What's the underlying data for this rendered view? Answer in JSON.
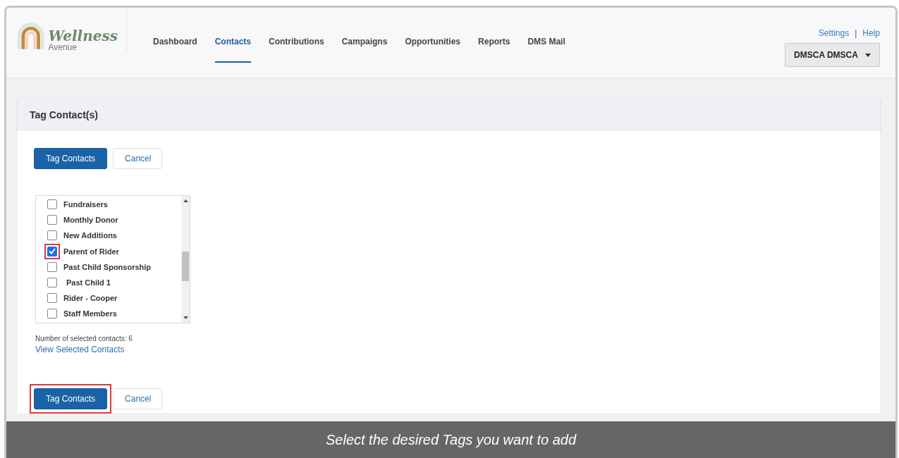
{
  "brand": {
    "name": "Wellness",
    "sub": "Avenue"
  },
  "nav": [
    {
      "label": "Dashboard",
      "selected": false
    },
    {
      "label": "Contacts",
      "selected": true
    },
    {
      "label": "Contributions",
      "selected": false
    },
    {
      "label": "Campaigns",
      "selected": false
    },
    {
      "label": "Opportunities",
      "selected": false
    },
    {
      "label": "Reports",
      "selected": false
    },
    {
      "label": "DMS Mail",
      "selected": false
    }
  ],
  "top_links": [
    "Settings",
    "Help"
  ],
  "separator": "|",
  "user_menu": "DMSCA DMSCA",
  "panel_title": "Tag Contact(s)",
  "top_buttons": [
    {
      "label": "Tag Contacts",
      "kind": "primary",
      "highlighted": false
    },
    {
      "label": "Cancel",
      "kind": "secondary",
      "highlighted": false
    }
  ],
  "tags": [
    {
      "label": "Fundraisers",
      "checked": false,
      "highlighted": false,
      "indented": false
    },
    {
      "label": "Monthly Donor",
      "checked": false,
      "highlighted": false,
      "indented": false
    },
    {
      "label": "New Additions",
      "checked": false,
      "highlighted": false,
      "indented": false
    },
    {
      "label": "Parent of Rider",
      "checked": true,
      "highlighted": true,
      "indented": false
    },
    {
      "label": "Past Child Sponsorship",
      "checked": false,
      "highlighted": false,
      "indented": false
    },
    {
      "label": "Past Child 1",
      "checked": false,
      "highlighted": false,
      "indented": true
    },
    {
      "label": "Rider - Cooper",
      "checked": false,
      "highlighted": false,
      "indented": false
    },
    {
      "label": "Staff Members",
      "checked": false,
      "highlighted": false,
      "indented": false
    }
  ],
  "selected_count": "Number of selected contacts: 6",
  "view_link": "View Selected Contacts",
  "bottom_buttons": [
    {
      "label": "Tag Contacts",
      "kind": "primary",
      "highlighted": true
    },
    {
      "label": "Cancel",
      "kind": "secondary",
      "highlighted": false
    }
  ],
  "caption": "Select the desired Tags you want to add"
}
